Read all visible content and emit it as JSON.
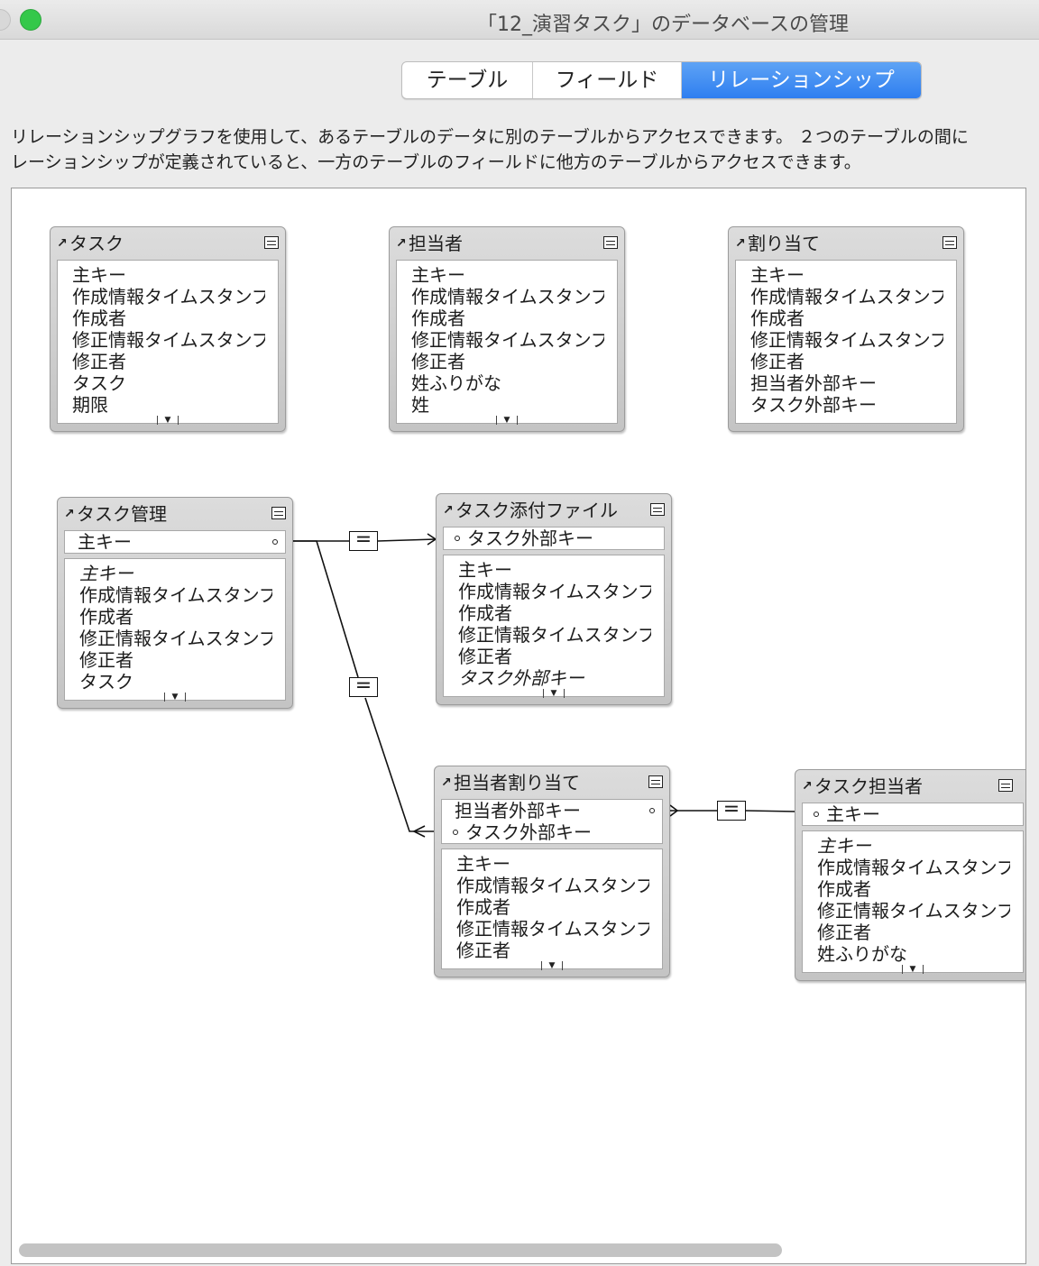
{
  "window": {
    "title": "「12_演習タスク」のデータベースの管理"
  },
  "tabs": [
    {
      "label": "テーブル"
    },
    {
      "label": "フィールド"
    },
    {
      "label": "リレーションシップ",
      "selected": true
    }
  ],
  "description": {
    "line1": "リレーションシップグラフを使用して、あるテーブルのデータに別のテーブルからアクセスできます。 ２つのテーブルの間に",
    "line2": "レーションシップが定義されていると、一方のテーブルのフィールドに他方のテーブルからアクセスできます。"
  },
  "relationship_operator": "=",
  "colors": {
    "accent": "#2e7ef0",
    "window_bg": "#ececec",
    "canvas_bg": "#ffffff",
    "table_header": "#c4c4c4"
  },
  "tables": [
    {
      "name": "タスク",
      "keys": [],
      "fields": [
        "主キー",
        "作成情報タイムスタンプ",
        "作成者",
        "修正情報タイムスタンプ",
        "修正者",
        "タスク",
        "期限"
      ]
    },
    {
      "name": "担当者",
      "keys": [],
      "fields": [
        "主キー",
        "作成情報タイムスタンプ",
        "作成者",
        "修正情報タイムスタンプ",
        "修正者",
        "姓ふりがな",
        "姓"
      ]
    },
    {
      "name": "割り当て",
      "keys": [],
      "fields": [
        "主キー",
        "作成情報タイムスタンプ",
        "作成者",
        "修正情報タイムスタンプ",
        "修正者",
        "担当者外部キー",
        "タスク外部キー"
      ]
    },
    {
      "name": "タスク管理",
      "keys": [
        "主キー"
      ],
      "fields": [
        "主キー",
        "作成情報タイムスタンプ",
        "作成者",
        "修正情報タイムスタンプ",
        "修正者",
        "タスク"
      ]
    },
    {
      "name": "タスク添付ファイル",
      "keys": [
        "タスク外部キー"
      ],
      "fields": [
        "主キー",
        "作成情報タイムスタンプ",
        "作成者",
        "修正情報タイムスタンプ",
        "修正者",
        "タスク外部キー"
      ]
    },
    {
      "name": "担当者割り当て",
      "keys": [
        "担当者外部キー",
        "タスク外部キー"
      ],
      "fields": [
        "主キー",
        "作成情報タイムスタンプ",
        "作成者",
        "修正情報タイムスタンプ",
        "修正者"
      ]
    },
    {
      "name": "タスク担当者",
      "keys": [
        "主キー"
      ],
      "fields": [
        "主キー",
        "作成情報タイムスタンプ",
        "作成者",
        "修正情報タイムスタンプ",
        "修正者",
        "姓ふりがな"
      ]
    }
  ]
}
